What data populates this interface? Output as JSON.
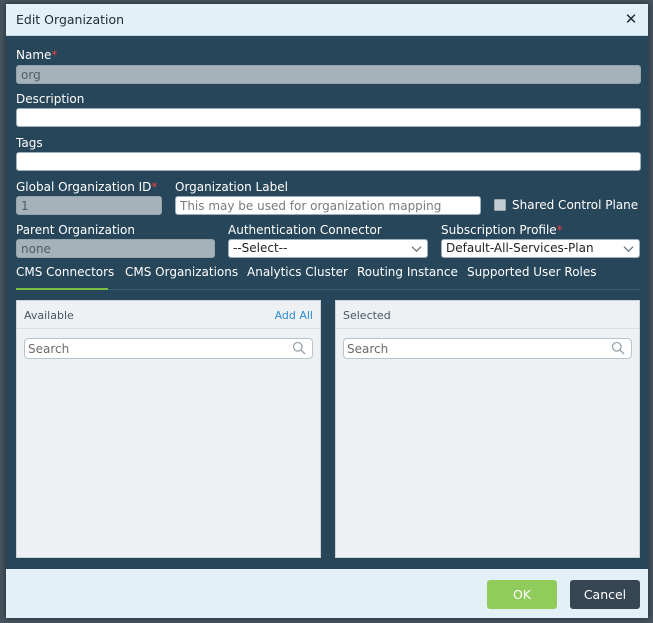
{
  "dialog": {
    "title": "Edit Organization",
    "close_glyph": "✕"
  },
  "form": {
    "name": {
      "label": "Name",
      "required_mark": "*",
      "value": "org"
    },
    "description": {
      "label": "Description",
      "value": ""
    },
    "tags": {
      "label": "Tags",
      "value": ""
    },
    "global_org_id": {
      "label": "Global Organization ID",
      "required_mark": "*",
      "value": "1"
    },
    "org_label": {
      "label": "Organization Label",
      "placeholder": "This may be used for organization mapping",
      "value": ""
    },
    "shared_control_plane": {
      "label": "Shared Control Plane",
      "checked": false
    },
    "parent_org": {
      "label": "Parent Organization",
      "value": "none"
    },
    "auth_connector": {
      "label": "Authentication Connector",
      "selected": "--Select--"
    },
    "subscription_profile": {
      "label": "Subscription Profile",
      "required_mark": "*",
      "selected": "Default-All-Services-Plan"
    }
  },
  "tabs": [
    {
      "label": "CMS Connectors",
      "active": true
    },
    {
      "label": "CMS Organizations",
      "active": false
    },
    {
      "label": "Analytics Cluster",
      "active": false
    },
    {
      "label": "Routing Instance",
      "active": false
    },
    {
      "label": "Supported User Roles",
      "active": false
    }
  ],
  "available": {
    "title": "Available",
    "add_all": "Add All",
    "search_placeholder": "Search"
  },
  "selected": {
    "title": "Selected",
    "search_placeholder": "Search"
  },
  "footer": {
    "ok_label": "OK",
    "cancel_label": "Cancel"
  },
  "colors": {
    "dialog_body": "#274659",
    "title_bar": "#e4f0f8",
    "ok_button": "#8fcc5c",
    "cancel_button": "#364753",
    "active_tab_underline": "#7cbf45",
    "required_mark": "#e8414a",
    "link": "#2d8bd4"
  },
  "icons": {
    "close": "close-icon",
    "chevron": "chevron-down-icon",
    "search": "search-icon"
  }
}
